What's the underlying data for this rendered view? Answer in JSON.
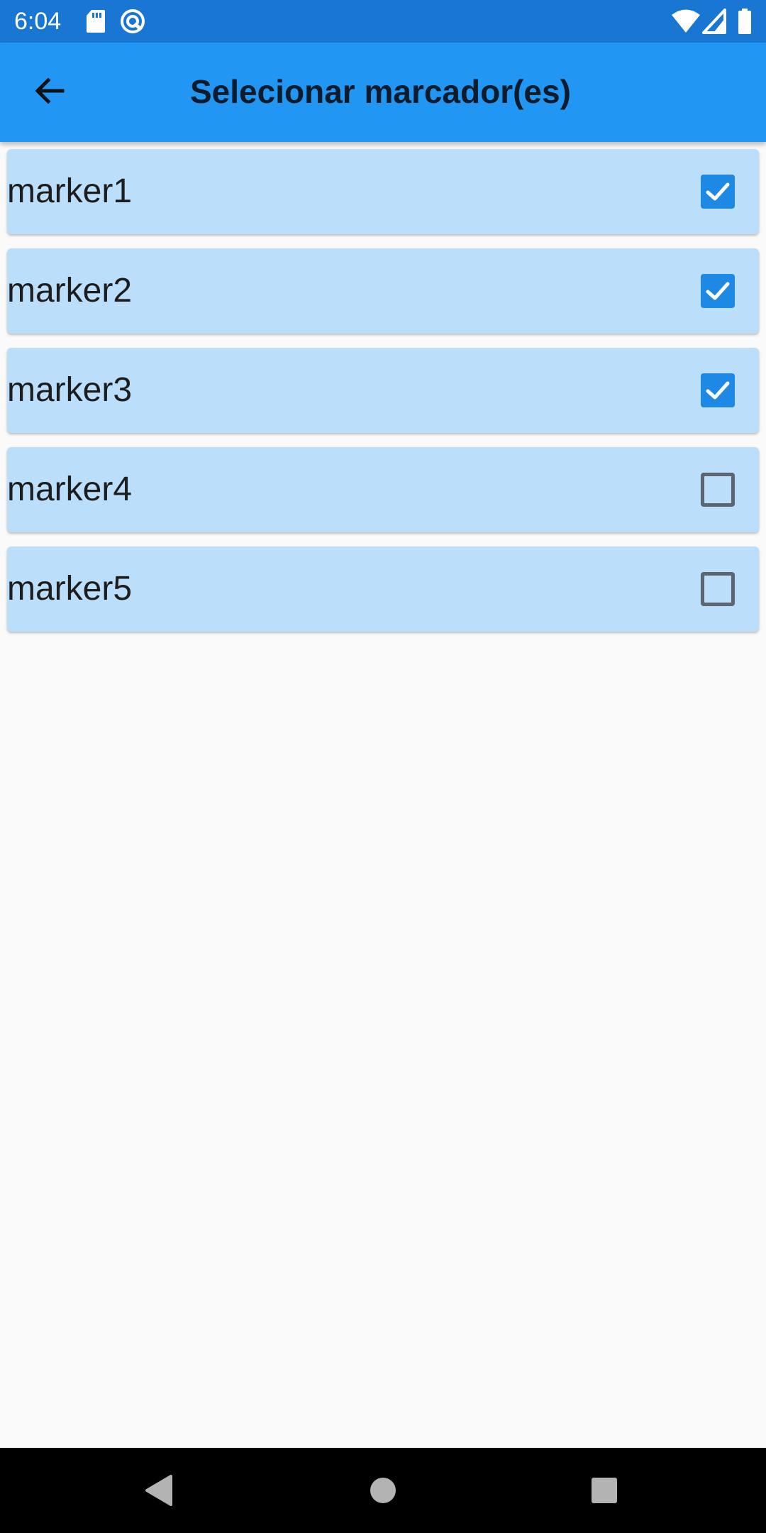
{
  "status_bar": {
    "time": "6:04",
    "left_icons": [
      "sd-card-icon",
      "sync-icon"
    ],
    "right_icons": [
      "wifi-icon",
      "cellular-signal-icon",
      "battery-icon"
    ]
  },
  "app_bar": {
    "back_icon": "arrow-back-icon",
    "title": "Selecionar marcador(es)"
  },
  "markers": [
    {
      "label": "marker1",
      "checked": true
    },
    {
      "label": "marker2",
      "checked": true
    },
    {
      "label": "marker3",
      "checked": true
    },
    {
      "label": "marker4",
      "checked": false
    },
    {
      "label": "marker5",
      "checked": false
    }
  ],
  "colors": {
    "status_bar": "#1976d2",
    "app_bar": "#2196f3",
    "card": "#bbdefb",
    "checkbox_checked": "#1e88e5",
    "background": "#fafafa"
  },
  "nav_bar": {
    "buttons": [
      "back-triangle-icon",
      "home-circle-icon",
      "recents-square-icon"
    ]
  }
}
